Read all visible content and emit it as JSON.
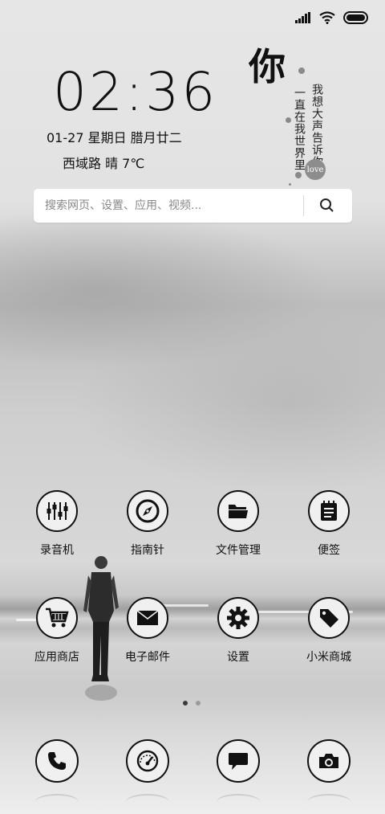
{
  "status_bar": {
    "icons": [
      "signal-icon",
      "wifi-icon",
      "battery-icon"
    ]
  },
  "clock": {
    "time": "02:36",
    "date": "01-27 星期日  腊月廿二",
    "weather": "西域路   晴   7℃"
  },
  "poem_widget": {
    "big_char": "你",
    "line1": "我想大声告诉你",
    "line2": "一直在我世界里",
    "badge": "love"
  },
  "search": {
    "placeholder": "搜索网页、设置、应用、视频...",
    "icon": "search-icon"
  },
  "apps_row1": [
    {
      "label": "录音机",
      "icon": "recorder-icon"
    },
    {
      "label": "指南针",
      "icon": "compass-icon"
    },
    {
      "label": "文件管理",
      "icon": "folder-icon"
    },
    {
      "label": "便签",
      "icon": "notepad-icon"
    }
  ],
  "apps_row2": [
    {
      "label": "应用商店",
      "icon": "shopping-cart-icon"
    },
    {
      "label": "电子邮件",
      "icon": "envelope-icon"
    },
    {
      "label": "设置",
      "icon": "gear-icon"
    },
    {
      "label": "小米商城",
      "icon": "price-tag-icon"
    }
  ],
  "pager": {
    "pages": 2,
    "active": 1
  },
  "dock": [
    {
      "icon": "phone-icon"
    },
    {
      "icon": "browser-icon"
    },
    {
      "icon": "message-icon"
    },
    {
      "icon": "camera-icon"
    }
  ]
}
